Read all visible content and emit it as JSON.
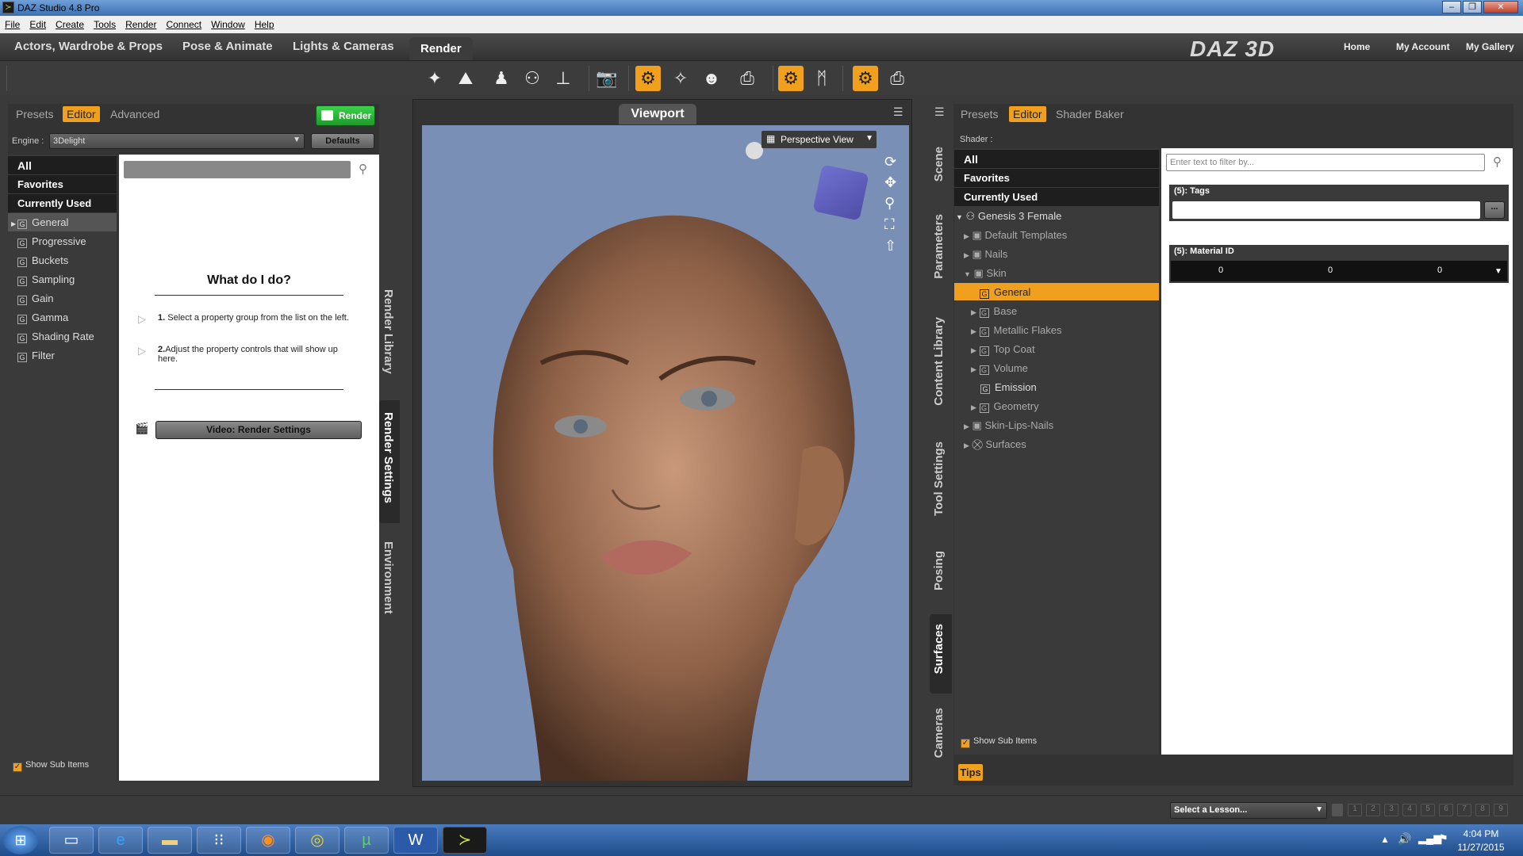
{
  "window": {
    "title": "DAZ Studio 4.8 Pro",
    "minimize": "–",
    "restore": "❐",
    "close": "✕"
  },
  "menu": [
    "File",
    "Edit",
    "Create",
    "Tools",
    "Render",
    "Connect",
    "Window",
    "Help"
  ],
  "workspace_tabs": [
    "Actors, Wardrobe & Props",
    "Pose & Animate",
    "Lights & Cameras",
    "Render"
  ],
  "brand": "DAZ 3D",
  "top_links": {
    "home": "Home",
    "account": "My Account",
    "gallery": "My Gallery"
  },
  "left_panel": {
    "tabs": {
      "presets": "Presets",
      "editor": "Editor",
      "advanced": "Advanced"
    },
    "render_button": "Render",
    "engine_label": "Engine :",
    "engine_value": "3Delight",
    "defaults_button": "Defaults",
    "categories": [
      "All",
      "Favorites",
      "Currently Used"
    ],
    "groups": [
      "General",
      "Progressive",
      "Buckets",
      "Sampling",
      "Gain",
      "Gamma",
      "Shading Rate",
      "Filter"
    ],
    "help_title": "What do I do?",
    "help_step1_num": "1.",
    "help_step1": "Select a property group from the list on the left.",
    "help_step2_num": "2.",
    "help_step2": "Adjust the property controls that will show up here.",
    "video_button": "Video: Render Settings",
    "show_sub_items": "Show Sub Items",
    "side_tabs": [
      "Render Library",
      "Render Settings",
      "Environment"
    ]
  },
  "viewport": {
    "title": "Viewport",
    "view_mode": "Perspective View"
  },
  "right_panel": {
    "side_tabs": [
      "Scene",
      "Parameters",
      "Content Library",
      "Tool Settings",
      "Posing",
      "Surfaces",
      "Cameras"
    ],
    "tabs": {
      "presets": "Presets",
      "editor": "Editor",
      "shader_baker": "Shader Baker"
    },
    "shader_label": "Shader :",
    "categories": [
      "All",
      "Favorites",
      "Currently Used"
    ],
    "figure": "Genesis 3 Female",
    "tree": [
      "Default Templates",
      "Nails",
      "Skin"
    ],
    "skin_children": [
      "General",
      "Base",
      "Metallic Flakes",
      "Top Coat",
      "Volume",
      "Emission",
      "Geometry"
    ],
    "tree_after": [
      "Skin-Lips-Nails",
      "Surfaces"
    ],
    "filter_placeholder": "Enter text to filter by...",
    "tags_header": "(5): Tags",
    "material_header": "(5): Material ID",
    "material_values": [
      "0",
      "0",
      "0"
    ],
    "show_sub_items": "Show Sub Items",
    "tips": "Tips"
  },
  "status": {
    "lesson": "Select a Lesson...",
    "pages": [
      "1",
      "2",
      "3",
      "4",
      "5",
      "6",
      "7",
      "8",
      "9"
    ]
  },
  "clock": {
    "time": "4:04 PM",
    "date": "11/27/2015"
  }
}
